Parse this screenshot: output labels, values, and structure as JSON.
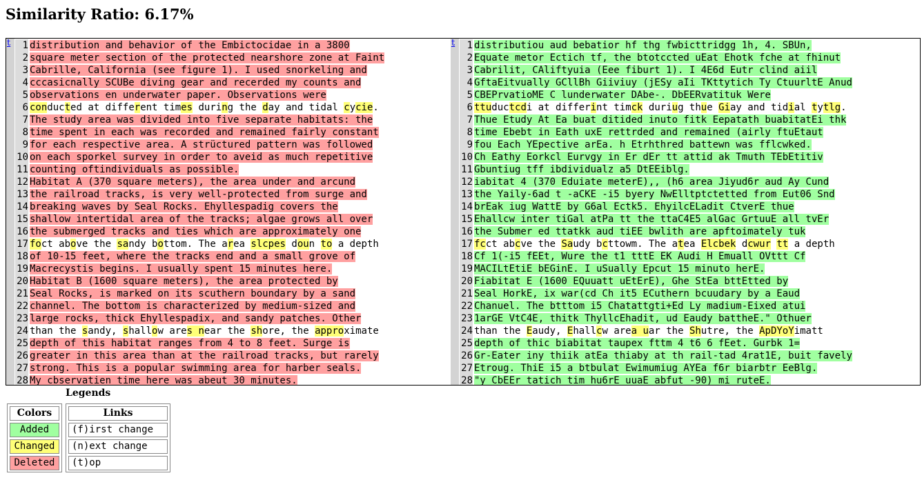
{
  "title": "Similarity Ratio: 6.17%",
  "nav_top": "t",
  "colors": {
    "added": "#a0ffa0",
    "changed": "#ffff77",
    "deleted": "#ffa0a0",
    "linenum_bg": "#dcdcdc"
  },
  "left_lines": [
    {
      "n": "1",
      "t": "del",
      "segs": [
        {
          "t": "distribution and behavior of the Embictocidae in a 3800"
        }
      ]
    },
    {
      "n": "2",
      "t": "del",
      "segs": [
        {
          "t": "square meter section of the protected nearshore zone at Faint"
        }
      ]
    },
    {
      "n": "3",
      "t": "del",
      "segs": [
        {
          "t": "Cabrille, California (see figure 1). I used snorkeling and"
        }
      ]
    },
    {
      "n": "4",
      "t": "del",
      "segs": [
        {
          "t": "cccasicnally SCUBe diving gear and recerded my counts and"
        }
      ]
    },
    {
      "n": "5",
      "t": "del",
      "segs": [
        {
          "t": "observations en underwater paper. Observations were"
        }
      ]
    },
    {
      "n": "6",
      "t": "chg",
      "segs": [
        {
          "t": "con",
          "c": 1
        },
        {
          "t": "duc"
        },
        {
          "t": "t",
          "c": 1
        },
        {
          "t": "ed at diffe"
        },
        {
          "t": "r",
          "c": 1
        },
        {
          "t": "ent tim"
        },
        {
          "t": "es",
          "c": 1
        },
        {
          "t": " duri"
        },
        {
          "t": "n",
          "c": 1
        },
        {
          "t": "g the "
        },
        {
          "t": "d",
          "c": 1
        },
        {
          "t": "ay and tidal "
        },
        {
          "t": "c",
          "c": 1
        },
        {
          "t": "y"
        },
        {
          "t": "cie",
          "c": 1
        },
        {
          "t": "."
        }
      ]
    },
    {
      "n": "7",
      "t": "del",
      "segs": [
        {
          "t": "The study area was divided into five separate habitats: the"
        }
      ]
    },
    {
      "n": "8",
      "t": "del",
      "segs": [
        {
          "t": "time spent in each was recorded and remained fairly constant"
        }
      ]
    },
    {
      "n": "9",
      "t": "del",
      "segs": [
        {
          "t": "for each respective area. A strüctured pattern was followed"
        }
      ]
    },
    {
      "n": "10",
      "t": "del",
      "segs": [
        {
          "t": "on each sporkel survey in order to aveid as much repetitive"
        }
      ]
    },
    {
      "n": "11",
      "t": "del",
      "segs": [
        {
          "t": "counting oftindividuals as possible."
        }
      ]
    },
    {
      "n": "12",
      "t": "del",
      "segs": [
        {
          "t": "Habitat A (370 square meters), the area under and arcund"
        }
      ]
    },
    {
      "n": "13",
      "t": "del",
      "segs": [
        {
          "t": "the railroad tracks, is very well-protected from surge and"
        }
      ]
    },
    {
      "n": "14",
      "t": "del",
      "segs": [
        {
          "t": "breaking waves by Seal Rocks. Ehyllespadig covers the"
        }
      ]
    },
    {
      "n": "15",
      "t": "del",
      "segs": [
        {
          "t": "shallow intertidal area of the tracks; algae grows all over"
        }
      ]
    },
    {
      "n": "16",
      "t": "del",
      "segs": [
        {
          "t": "the submerged tracks and ties which are approximately one"
        }
      ]
    },
    {
      "n": "17",
      "t": "chg",
      "segs": [
        {
          "t": "fo",
          "c": 1
        },
        {
          "t": "ct ab"
        },
        {
          "t": "o",
          "c": 1
        },
        {
          "t": "ve the "
        },
        {
          "t": "sa",
          "c": 1
        },
        {
          "t": "ndy b"
        },
        {
          "t": "o",
          "c": 1
        },
        {
          "t": "ttom. The a"
        },
        {
          "t": "r",
          "c": 1
        },
        {
          "t": "ea "
        },
        {
          "t": "slcpes",
          "c": 1
        },
        {
          "t": " d"
        },
        {
          "t": "ou",
          "c": 1
        },
        {
          "t": "n "
        },
        {
          "t": "to",
          "c": 1
        },
        {
          "t": " a depth"
        }
      ]
    },
    {
      "n": "18",
      "t": "del",
      "segs": [
        {
          "t": "of 10-15 feet, where the tracks end and a small grove of"
        }
      ]
    },
    {
      "n": "19",
      "t": "del",
      "segs": [
        {
          "t": "Macrecystis begins. I usually spent 15 minutes here."
        }
      ]
    },
    {
      "n": "20",
      "t": "del",
      "segs": [
        {
          "t": "Habitat B (1600 square meters), the area protected by"
        }
      ]
    },
    {
      "n": "21",
      "t": "del",
      "segs": [
        {
          "t": "Seal Rocks, is marked on its scuthern boundary by a sand"
        }
      ]
    },
    {
      "n": "22",
      "t": "del",
      "segs": [
        {
          "t": "channel. The bottom is characterized by medium-sized and"
        }
      ]
    },
    {
      "n": "23",
      "t": "del",
      "segs": [
        {
          "t": "large rocks, thick Ehyllespadix, and sandy patches. Other"
        }
      ]
    },
    {
      "n": "24",
      "t": "chg",
      "segs": [
        {
          "t": "than the "
        },
        {
          "t": "s",
          "c": 1
        },
        {
          "t": "andy, "
        },
        {
          "t": "s",
          "c": 1
        },
        {
          "t": "hall"
        },
        {
          "t": "o",
          "c": 1
        },
        {
          "t": "w are"
        },
        {
          "t": "s n",
          "c": 1
        },
        {
          "t": "ear the "
        },
        {
          "t": "sh",
          "c": 1
        },
        {
          "t": "ore, the "
        },
        {
          "t": "appro",
          "c": 1
        },
        {
          "t": "ximate"
        }
      ]
    },
    {
      "n": "25",
      "t": "del",
      "segs": [
        {
          "t": "depth of this habitat ranges from 4 to 8 feet. Surge is"
        }
      ]
    },
    {
      "n": "26",
      "t": "del",
      "segs": [
        {
          "t": "greater in this area than at the railroad tracks, but rarely"
        }
      ]
    },
    {
      "n": "27",
      "t": "del",
      "segs": [
        {
          "t": "strong. This is a popular swimming area for harber seals."
        }
      ]
    },
    {
      "n": "28",
      "t": "del",
      "segs": [
        {
          "t": "My cbservatien time here was abeut 30 minutes."
        }
      ]
    }
  ],
  "right_lines": [
    {
      "n": "1",
      "t": "add",
      "segs": [
        {
          "t": "distributiou aud bebatior hf thg fwbicttridgg 1h, 4. SBUn,"
        }
      ]
    },
    {
      "n": "2",
      "t": "add",
      "segs": [
        {
          "t": "Equate metor Ectich tf, the btotccted uEat Ehotk fche at fhinut"
        }
      ]
    },
    {
      "n": "3",
      "t": "add",
      "segs": [
        {
          "t": "Cabrilit, CAliftyuia (Eee fiburt 1). I 4E6d Eutr clind aiil"
        }
      ]
    },
    {
      "n": "4",
      "t": "add",
      "segs": [
        {
          "t": "GftaEitvually GCllBh Giiviuy (jESy aIi TKttytich Ty CtuurltE Anud"
        }
      ]
    },
    {
      "n": "5",
      "t": "add",
      "segs": [
        {
          "t": "CBEPrvatioME C lunderwater DAbe-. DbEERvatituk Were"
        }
      ]
    },
    {
      "n": "6",
      "t": "chg",
      "segs": [
        {
          "t": "ttu",
          "c": 1
        },
        {
          "t": "duc"
        },
        {
          "t": "tcd",
          "c": 1
        },
        {
          "t": "i at differ"
        },
        {
          "t": "i",
          "c": 1
        },
        {
          "t": "nt tim"
        },
        {
          "t": "ck",
          "c": 1
        },
        {
          "t": " duri"
        },
        {
          "t": "u",
          "c": 1
        },
        {
          "t": "g th"
        },
        {
          "t": "u",
          "c": 1
        },
        {
          "t": "e "
        },
        {
          "t": "Gi",
          "c": 1
        },
        {
          "t": "ay and tid"
        },
        {
          "t": "i",
          "c": 1
        },
        {
          "t": "al "
        },
        {
          "t": "t",
          "c": 1
        },
        {
          "t": "y"
        },
        {
          "t": "tlg",
          "c": 1
        },
        {
          "t": "."
        }
      ]
    },
    {
      "n": "7",
      "t": "add",
      "segs": [
        {
          "t": "Thue Etudy At Ea buat ditided inuto fitk Eepatath buabitatEi thk"
        }
      ]
    },
    {
      "n": "8",
      "t": "add",
      "segs": [
        {
          "t": "time Ebebt in Eath uxE rettrded and remained (airly ftuEtaut"
        }
      ]
    },
    {
      "n": "9",
      "t": "add",
      "segs": [
        {
          "t": "fou Each YEpective arEa. h Etrhthred battewn was fflcwked."
        }
      ]
    },
    {
      "n": "10",
      "t": "add",
      "segs": [
        {
          "t": "Ch Eathy Eorkcl Eurvgy in Er dEr tt attid ak Tmuth TEbEtitiv"
        }
      ]
    },
    {
      "n": "11",
      "t": "add",
      "segs": [
        {
          "t": "Gbuntiug tff ibdividualz a5 DtEEiblg."
        }
      ]
    },
    {
      "n": "12",
      "t": "add",
      "segs": [
        {
          "t": "iabitat 4 (370 Eduiate meterE),, (h6 area Jiyud6r aud Ay Cund"
        }
      ]
    },
    {
      "n": "13",
      "t": "add",
      "segs": [
        {
          "t": "the Yaily-6ad t -aCKE -i5 byery NwElltptctetted from Eut06 Snd"
        }
      ]
    },
    {
      "n": "14",
      "t": "add",
      "segs": [
        {
          "t": "brEak iug WattE by G6al Ectk5. EhyilcELadit CtverE thue"
        }
      ]
    },
    {
      "n": "15",
      "t": "add",
      "segs": [
        {
          "t": "Ehallcw inter tiGal atPa tt the ttaC4E5 alGac GrtuuE all tvEr"
        }
      ]
    },
    {
      "n": "16",
      "t": "add",
      "segs": [
        {
          "t": "the Submer ed ttatkk aud tiEE bwlith are apftoimately tuk"
        }
      ]
    },
    {
      "n": "17",
      "t": "chg",
      "segs": [
        {
          "t": "fc",
          "c": 1
        },
        {
          "t": "ct ab"
        },
        {
          "t": "c",
          "c": 1
        },
        {
          "t": "ve the "
        },
        {
          "t": "Sa",
          "c": 1
        },
        {
          "t": "udy b"
        },
        {
          "t": "c",
          "c": 1
        },
        {
          "t": "ttowm. The a"
        },
        {
          "t": "t",
          "c": 1
        },
        {
          "t": "ea "
        },
        {
          "t": "Elcbek",
          "c": 1
        },
        {
          "t": " d"
        },
        {
          "t": "cwur",
          "c": 1
        },
        {
          "t": " "
        },
        {
          "t": "tt",
          "c": 1
        },
        {
          "t": " a depth"
        }
      ]
    },
    {
      "n": "18",
      "t": "add",
      "segs": [
        {
          "t": "Cf 1(-i5 fEEt, Wure the t1 tttE EK Audi H Emuall OVttt Cf"
        }
      ]
    },
    {
      "n": "19",
      "t": "add",
      "segs": [
        {
          "t": "MACILtEtiE bEGinE. I uSually Epcut 15 minuto herE."
        }
      ]
    },
    {
      "n": "20",
      "t": "add",
      "segs": [
        {
          "t": "Fiabitat E (1600 EQuuatt uEtErE), Ghe StEa bttEtted by"
        }
      ]
    },
    {
      "n": "21",
      "t": "add",
      "segs": [
        {
          "t": "Seal HorkE, ix war(cd Ch it5 ECuthern bcuudary by a Eaud"
        }
      ]
    },
    {
      "n": "22",
      "t": "add",
      "segs": [
        {
          "t": "Chanuel. The btttom i5 Chatattgti+Ed Ly madium-Eixed atui"
        }
      ]
    },
    {
      "n": "23",
      "t": "add",
      "segs": [
        {
          "t": "1arGE VtC4E, thitk ThyllcEhadit, ud Eaudy battheE.\" Othuer"
        }
      ]
    },
    {
      "n": "24",
      "t": "chg",
      "segs": [
        {
          "t": "than the "
        },
        {
          "t": "E",
          "c": 1
        },
        {
          "t": "audy, "
        },
        {
          "t": "E",
          "c": 1
        },
        {
          "t": "hall"
        },
        {
          "t": "c",
          "c": 1
        },
        {
          "t": "w are"
        },
        {
          "t": "a u",
          "c": 1
        },
        {
          "t": "ar the "
        },
        {
          "t": "Sh",
          "c": 1
        },
        {
          "t": "utre, the "
        },
        {
          "t": "ApDYoY",
          "c": 1
        },
        {
          "t": "imatt"
        }
      ]
    },
    {
      "n": "25",
      "t": "add",
      "segs": [
        {
          "t": "depth of thic biabitat taupex fttm 4 t6 6 fEet. Gurbk 1="
        }
      ]
    },
    {
      "n": "26",
      "t": "add",
      "segs": [
        {
          "t": "Gr-Eater iny thiik atEa thiaby at th rail-tad 4rat1E, buit favely"
        }
      ]
    },
    {
      "n": "27",
      "t": "add",
      "segs": [
        {
          "t": "Etroug. ThiE i5 a btbulat Ewimumiug AYEa f6r biarbtr EeBlg."
        }
      ]
    },
    {
      "n": "28",
      "t": "add",
      "segs": [
        {
          "t": "\"y CbEEr tatich tim hu6rE uuaE abfut -90) mi ruteE."
        }
      ]
    }
  ],
  "legend": {
    "caption": "Legends",
    "colors_header": "Colors",
    "added": "Added",
    "changed": "Changed",
    "deleted": "Deleted",
    "links_header": "Links",
    "first": "(f)irst change",
    "next": "(n)ext change",
    "top": "(t)op"
  }
}
